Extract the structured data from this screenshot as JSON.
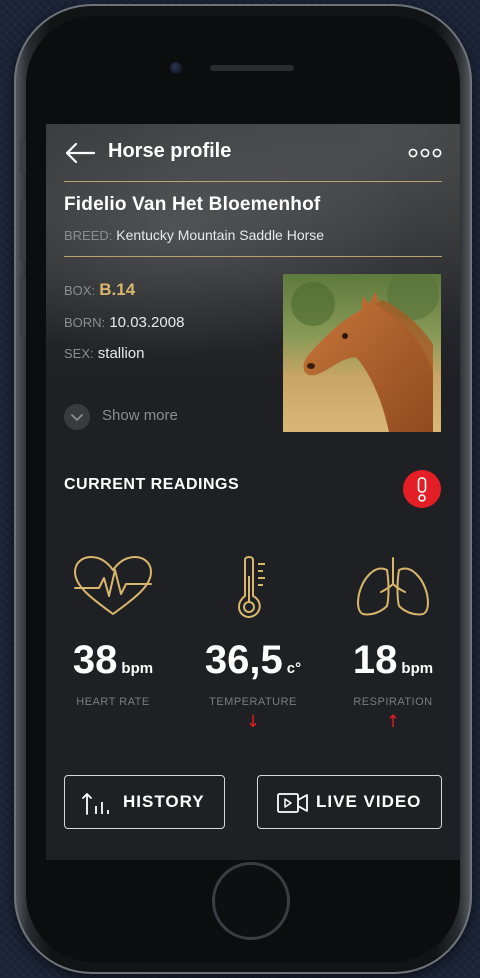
{
  "header": {
    "title": "Horse profile"
  },
  "horse": {
    "name": "Fidelio Van Het Bloemenhof",
    "breed_label": "BREED:",
    "breed": "Kentucky Mountain Saddle Horse",
    "box_label": "BOX:",
    "box": "B.14",
    "born_label": "BORN:",
    "born": "10.03.2008",
    "sex_label": "SEX:",
    "sex": "stallion"
  },
  "show_more": "Show more",
  "readings": {
    "title": "CURRENT READINGS",
    "alert_symbol": "!",
    "items": [
      {
        "value": "38",
        "unit": "bpm",
        "name": "HEART RATE",
        "trend": "",
        "icon": "heart-rate-icon"
      },
      {
        "value": "36,5",
        "unit": "c°",
        "name": "TEMPERATURE",
        "trend": "↓",
        "icon": "thermometer-icon"
      },
      {
        "value": "18",
        "unit": "bpm",
        "name": "RESPIRATION",
        "trend": "↑",
        "icon": "lungs-icon"
      }
    ]
  },
  "actions": {
    "history": "HISTORY",
    "live_video": "LIVE VIDEO"
  },
  "colors": {
    "accent_gold": "#d8b66d",
    "alert_red": "#e41e26",
    "screen_bg": "#1f2023"
  }
}
